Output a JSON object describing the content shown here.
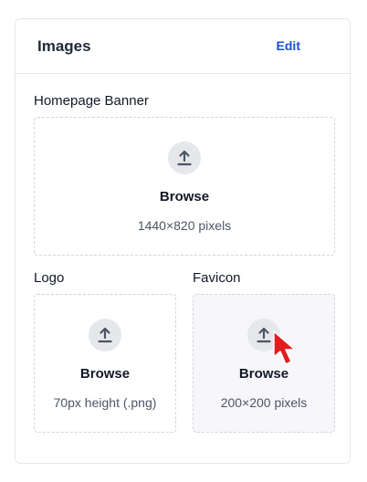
{
  "card": {
    "title": "Images",
    "edit_label": "Edit"
  },
  "homepage_banner": {
    "label": "Homepage Banner",
    "browse_label": "Browse",
    "hint": "1440×820 pixels",
    "icon": "upload-icon"
  },
  "logo": {
    "label": "Logo",
    "browse_label": "Browse",
    "hint": "70px height (.png)",
    "icon": "upload-icon"
  },
  "favicon": {
    "label": "Favicon",
    "browse_label": "Browse",
    "hint": "200×200 pixels",
    "icon": "upload-icon"
  },
  "colors": {
    "accent": "#1d4ed8",
    "hover_background": "#f7f7fb",
    "cursor": "#e11d1d"
  }
}
